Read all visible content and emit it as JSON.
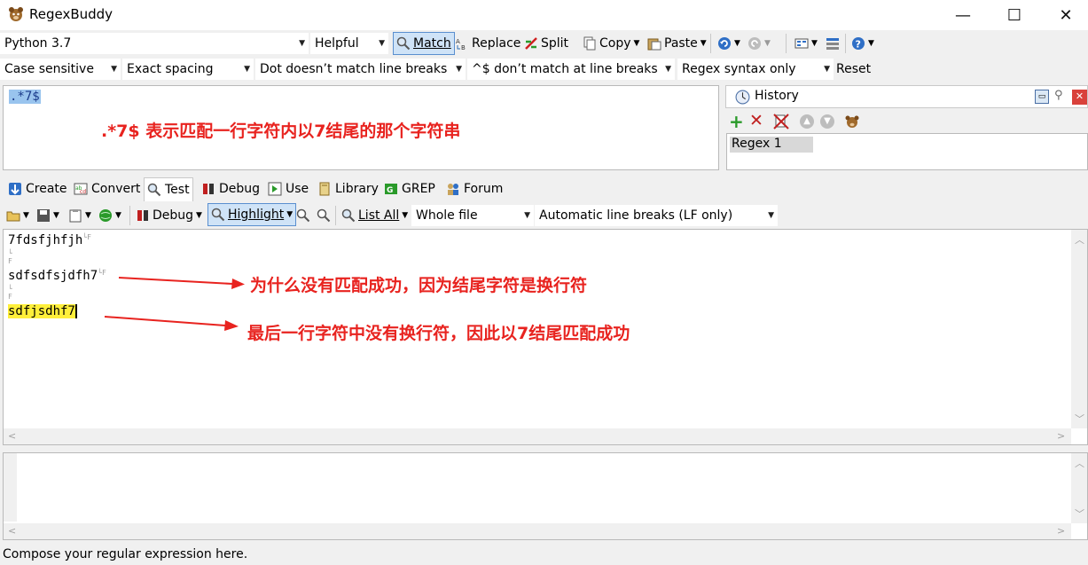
{
  "window": {
    "title": "RegexBuddy",
    "minimize": "—",
    "maximize": "☐",
    "close": "✕"
  },
  "toolbar1": {
    "flavor": "Python 3.7",
    "helpful": "Helpful",
    "match": "Match",
    "replace": "Replace",
    "split": "Split",
    "copy": "Copy",
    "paste": "Paste"
  },
  "toolbar2": {
    "case": "Case sensitive",
    "spacing": "Exact spacing",
    "dot": "Dot doesn’t match line breaks",
    "anchors": "^$ don’t match at line breaks",
    "syntax": "Regex syntax only",
    "reset": "Reset"
  },
  "regex": {
    "value": ".*7$",
    "annotation": ".*7$ 表示匹配一行字符内以7结尾的那个字符串"
  },
  "history": {
    "title": "History",
    "items": [
      "Regex 1"
    ]
  },
  "tabs": [
    "Create",
    "Convert",
    "Test",
    "Debug",
    "Use",
    "Library",
    "GREP",
    "Forum"
  ],
  "test_toolbar": {
    "debug": "Debug",
    "highlight": "Highlight",
    "list_all": "List All",
    "scope": "Whole file",
    "line_breaks": "Automatic line breaks (LF only)"
  },
  "test_text": {
    "line1": "7fdsfjhfjh",
    "line2": "sdfsdfsjdfh7",
    "line3": "sdfjsdhf7"
  },
  "annotations": {
    "note1": "为什么没有匹配成功，因为结尾字符是换行符",
    "note2": "最后一行字符中没有换行符，因此以7结尾匹配成功"
  },
  "status": "Compose your regular expression here.",
  "colors": {
    "annotation": "#e8231f",
    "match_highlight": "#ffef3a",
    "regex_highlight": "#99c4ee"
  }
}
